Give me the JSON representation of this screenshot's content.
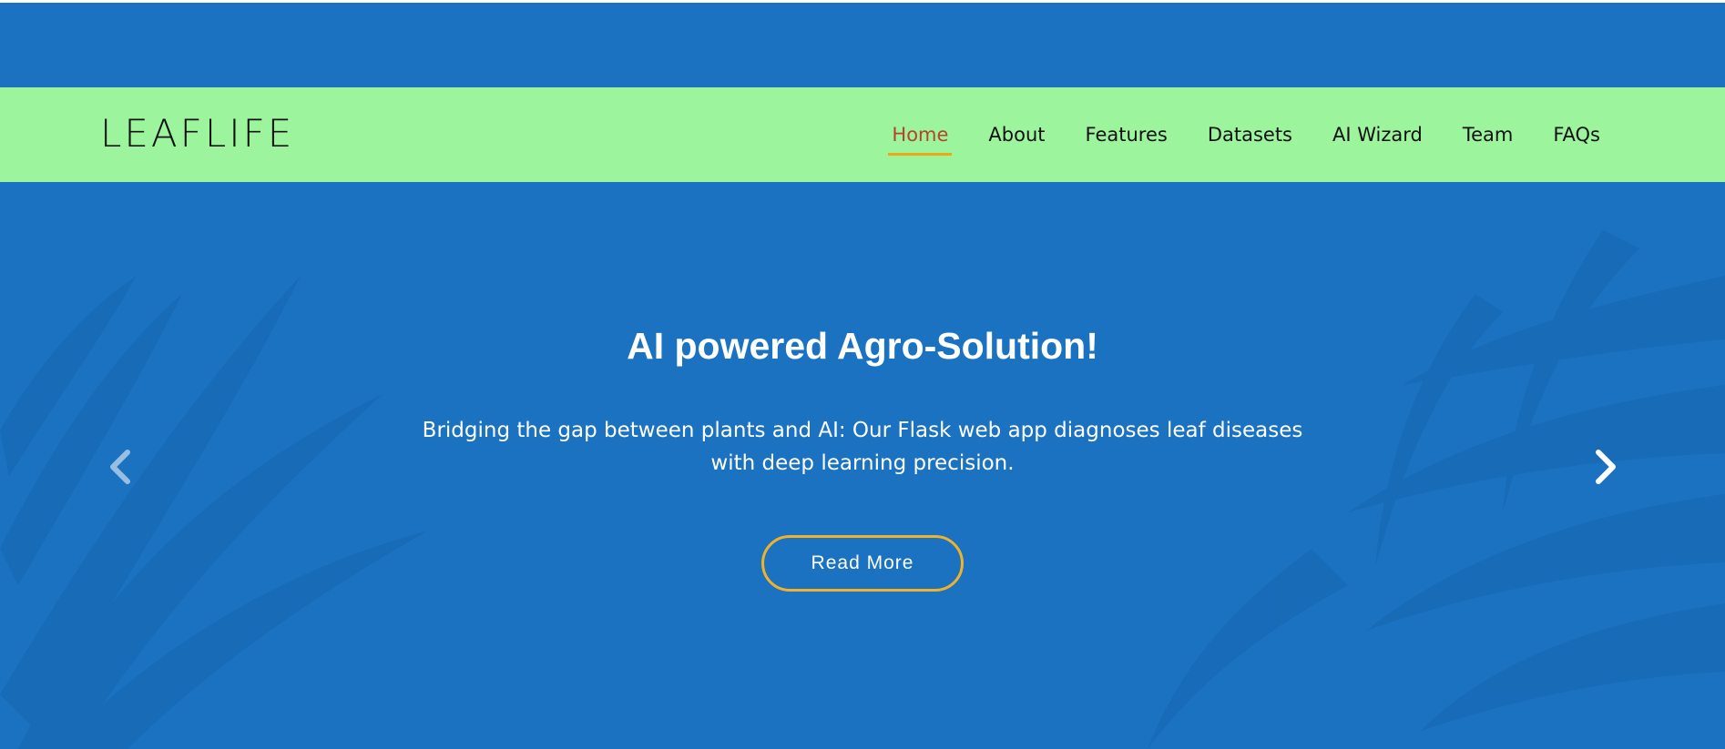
{
  "brand": {
    "logo_text": "LEAFLIFE"
  },
  "nav": {
    "items": [
      {
        "label": "Home",
        "active": true
      },
      {
        "label": "About"
      },
      {
        "label": "Features"
      },
      {
        "label": "Datasets"
      },
      {
        "label": "AI Wizard"
      },
      {
        "label": "Team"
      },
      {
        "label": "FAQs"
      }
    ]
  },
  "hero": {
    "headline": "AI powered Agro-Solution!",
    "subtext": "Bridging the gap between plants and AI: Our Flask web app diagnoses leaf diseases with deep learning precision.",
    "cta_label": "Read More"
  },
  "carousel": {
    "prev_icon": "chevron-left-icon",
    "next_icon": "chevron-right-icon"
  },
  "colors": {
    "hero_background": "#1a72c0",
    "navbar_background": "#9cf49c",
    "active_nav_text": "#b5442a",
    "accent": "#f0a712",
    "text_light": "#ffffff",
    "text_dark": "#111111"
  }
}
